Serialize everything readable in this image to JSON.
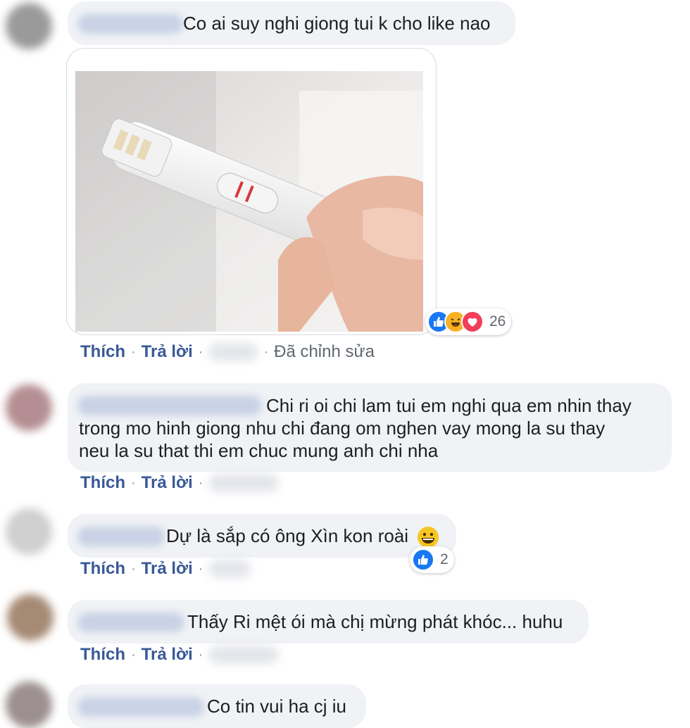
{
  "colors": {
    "bubble_bg": "#f0f2f5",
    "link": "#385898",
    "like_blue": "#1877f2"
  },
  "comments": [
    {
      "text": "Co ai suy nghi giong tui k cho like nao",
      "actions": {
        "like": "Thích",
        "reply": "Trả lời",
        "edited": "Đã chỉnh sửa"
      },
      "attachment": {
        "icon": "pregnancy-test-photo"
      },
      "reactions": {
        "icons": [
          "like-icon",
          "haha-icon",
          "love-icon"
        ],
        "count": "26"
      }
    },
    {
      "lines": [
        "Chi ri oi chi lam tui em nghi qua em nhin thay",
        "trong mo hinh giong nhu chi đang om nghen vay mong la su thay",
        "neu la su that thi em chuc mung anh chi nha"
      ],
      "actions": {
        "like": "Thích",
        "reply": "Trả lời"
      }
    },
    {
      "text": "Dự là sắp có ông Xìn kon roài",
      "emoji": "grinning-face-icon",
      "actions": {
        "like": "Thích",
        "reply": "Trả lời"
      },
      "reactions": {
        "icons": [
          "like-icon"
        ],
        "count": "2"
      }
    },
    {
      "text": "Thấy Ri mệt ói mà chị mừng phát khóc... huhu",
      "actions": {
        "like": "Thích",
        "reply": "Trả lời"
      }
    },
    {
      "text": "Co tin vui ha cj iu"
    }
  ],
  "separator": "·"
}
